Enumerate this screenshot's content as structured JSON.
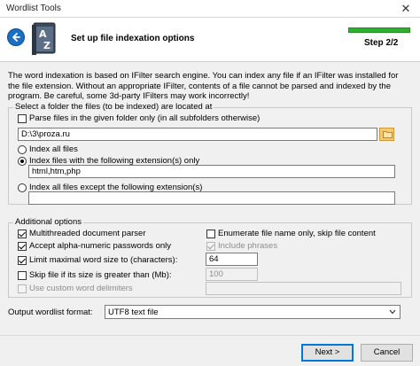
{
  "window": {
    "title": "Wordlist Tools",
    "close_glyph": "✕"
  },
  "header": {
    "title": "Set up file indexation options",
    "step": "Step 2/2",
    "progress": 1.0
  },
  "description": "The word indexation is based on IFilter search engine. You can index any file if an IFilter was installed for the file extension. Without an appropriate IFilter, contents of a file cannot be parsed and indexed by the program. Be careful, some 3d-party IFilters may work incorrectly!",
  "folder_group": {
    "label": "Select a folder the files (to be indexed) are located at",
    "parse_given_only": {
      "label": "Parse files in the given folder only (in all subfolders otherwise)",
      "checked": false
    },
    "folder_path": "D:\\3\\proza.ru",
    "index_all": {
      "label": "Index all files",
      "selected": false
    },
    "index_ext": {
      "label": "Index files with the following extension(s) only",
      "selected": true
    },
    "ext_value": "html,htm,php",
    "index_except": {
      "label": "Index all files except the following extension(s)",
      "selected": false
    },
    "except_value": ""
  },
  "options_group": {
    "label": "Additional options",
    "multithreaded": {
      "label": "Multithreaded document parser",
      "checked": true
    },
    "alnum": {
      "label": "Accept alpha-numeric passwords only",
      "checked": true
    },
    "limit_word": {
      "label": "Limit maximal word size to (characters):",
      "checked": true,
      "value": "64"
    },
    "skip_size": {
      "label": "Skip file if its size is greater than (Mb):",
      "checked": false,
      "value": "100"
    },
    "custom_delims": {
      "label": "Use custom word delimiters",
      "checked": false
    },
    "enum_names": {
      "label": "Enumerate file name only, skip file content",
      "checked": false
    },
    "include_phrases": {
      "label": "Include phrases",
      "checked": true
    }
  },
  "output_format": {
    "label": "Output wordlist format:",
    "value": "UTF8 text file"
  },
  "buttons": {
    "next": "Next >",
    "cancel": "Cancel"
  }
}
